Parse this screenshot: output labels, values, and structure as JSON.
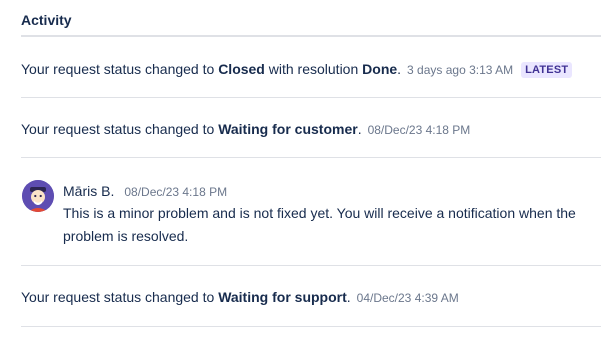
{
  "activity": {
    "heading": "Activity",
    "entries": [
      {
        "prefix": "Your request status changed to ",
        "status": "Closed",
        "middle": " with resolution ",
        "resolution": "Done",
        "suffix": ".",
        "timestamp": "3 days ago 3:13 AM",
        "badge": "LATEST"
      },
      {
        "prefix": "Your request status changed to ",
        "status": "Waiting for customer",
        "suffix": ".",
        "timestamp": "08/Dec/23 4:18 PM"
      },
      {
        "type": "comment",
        "author": "Māris B.",
        "timestamp": "08/Dec/23 4:18 PM",
        "body": "This is a minor problem and is not fixed yet. You will receive a notification when the problem is resolved.",
        "avatar_icon": "user-avatar-icon"
      },
      {
        "prefix": "Your request status changed to ",
        "status": "Waiting for support",
        "suffix": ".",
        "timestamp": "04/Dec/23 4:39 AM"
      }
    ]
  },
  "colors": {
    "text": "#172b4d",
    "muted": "#6b778c",
    "divider": "#dfe1e6",
    "badge_bg": "#eae6ff",
    "badge_text": "#403294",
    "avatar_bg": "#5e4db2"
  }
}
